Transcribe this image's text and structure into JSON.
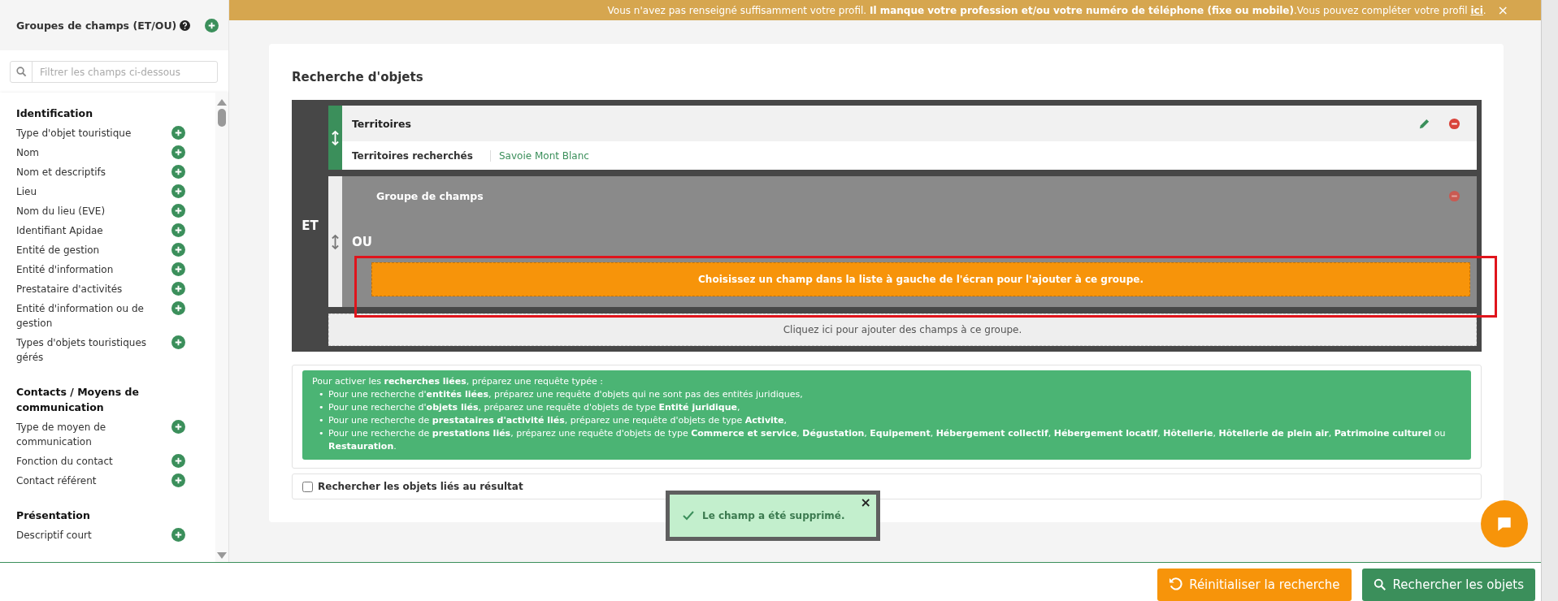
{
  "banner": {
    "text": "Vous n'avez pas renseigné suffisamment votre profil. **Il manque votre profession et/ou votre numéro de téléphone (fixe ou mobile)**.Vous pouvez compléter votre profil",
    "link": "ici",
    "suffix": ".",
    "close": "×"
  },
  "sidebar": {
    "title": "Groupes de champs (ET/OU)",
    "search": {
      "placeholder": "Filtrer les champs ci-dessous"
    },
    "sections": [
      {
        "title": "Identification",
        "items": [
          {
            "label": "Type d'objet touristique"
          },
          {
            "label": "Nom"
          },
          {
            "label": "Nom et descriptifs"
          },
          {
            "label": "Lieu"
          },
          {
            "label": "Nom du lieu (EVE)"
          },
          {
            "label": "Identifiant Apidae"
          },
          {
            "label": "Entité de gestion"
          },
          {
            "label": "Entité d'information"
          },
          {
            "label": "Prestataire d'activités"
          },
          {
            "label": "Entité d'information ou de gestion"
          },
          {
            "label": "Types d'objets touristiques gérés"
          }
        ]
      },
      {
        "title": "Contacts / Moyens de communication",
        "items": [
          {
            "label": "Type de moyen de communication"
          },
          {
            "label": "Fonction du contact"
          },
          {
            "label": "Contact référent"
          }
        ]
      },
      {
        "title": "Présentation",
        "items": [
          {
            "label": "Descriptif court"
          }
        ]
      }
    ]
  },
  "search_panel": {
    "title": "Recherche d'objets",
    "operator": "ET",
    "blocks": [
      {
        "kind": "field",
        "title": "Territoires",
        "rows": [
          {
            "label": "Territoires recherchés",
            "value": "Savoie Mont Blanc"
          }
        ]
      },
      {
        "kind": "group",
        "title": "Groupe de champs",
        "operator": "OU",
        "prompt": "Choisissez un champ dans la liste à gauche de l'écran pour l'ajouter à ce groupe."
      }
    ],
    "add_hint": "Cliquez ici pour ajouter des champs à ce groupe."
  },
  "info": {
    "intro": "Pour activer les **recherches liées**, préparez une requête typée :",
    "bullets": [
      {
        "marker": "•",
        "text": "Pour une recherche d'**entités liées**, préparez une requête d'objets qui ne sont pas des entités juridiques,"
      },
      {
        "marker": "•",
        "text": "Pour une recherche d'**objets liés**, préparez une requête d'objets de type **Entité juridique**,"
      },
      {
        "marker": "•",
        "text": "Pour une recherche de **prestataires d'activité liés**, préparez une requête d'objets de type **Activite**,"
      },
      {
        "marker": "•",
        "text": "Pour une recherche de **prestations liés**, préparez une requête d'objets de type **Commerce et service**, **Dégustation**, **Equipement**, **Hébergement collectif**, **Hébergement locatif**, **Hôtellerie**, **Hôtellerie de plein air**, **Patrimoine culturel** ou **Restauration**."
      }
    ]
  },
  "linked_results": {
    "label": "Rechercher les objets liés au résultat",
    "checked": false
  },
  "toast": {
    "message": "Le champ a été supprimé.",
    "close": "×"
  },
  "buttons": [
    {
      "kind": "reset",
      "label": "Réinitialiser la recherche"
    },
    {
      "kind": "search",
      "label": "Rechercher les objets"
    }
  ]
}
